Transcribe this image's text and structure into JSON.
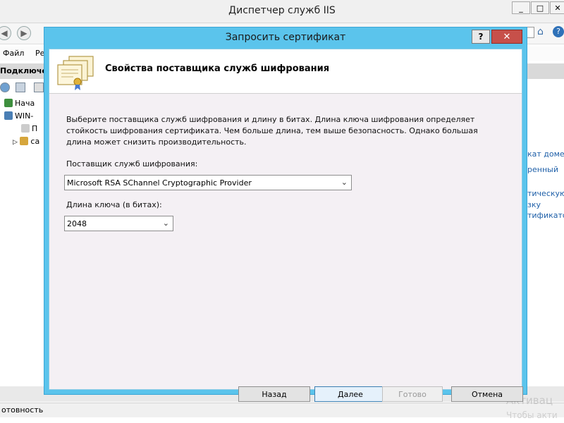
{
  "background": {
    "title": "Диспетчер служб IIS",
    "menu": [
      "Файл",
      "Ре"
    ],
    "connections_header": "Подключения",
    "tree": [
      "Нача",
      "WIN-",
      "П",
      "са"
    ],
    "right_links": [
      "кат домен",
      "ренный",
      "тическую",
      "зку",
      "тификато"
    ],
    "status": "отовность",
    "watermark_line1": "Активац",
    "watermark_line2": "Чтобы акти"
  },
  "dialog": {
    "title": "Запросить сертификат",
    "help_label": "?",
    "close_label": "✕",
    "heading": "Свойства поставщика служб шифрования",
    "description": "Выберите поставщика служб шифрования и длину в битах. Длина ключа шифрования определяет стойкость шифрования сертификата. Чем больше длина, тем выше безопасность. Однако большая длина может снизить производительность.",
    "provider_label": "Поставщик служб шифрования:",
    "provider_value": "Microsoft RSA SChannel Cryptographic Provider",
    "keylength_label": "Длина ключа (в битах):",
    "keylength_value": "2048",
    "buttons": {
      "back": "Назад",
      "next": "Далее",
      "finish": "Готово",
      "cancel": "Отмена"
    }
  }
}
